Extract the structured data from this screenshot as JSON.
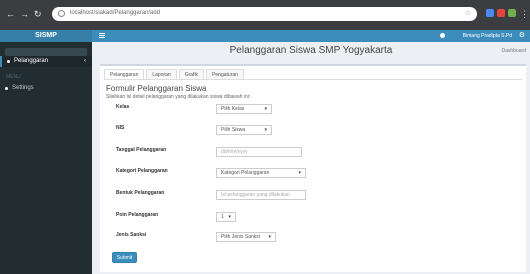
{
  "browser": {
    "url": "localhost/siakad/Pelanggaran/add",
    "colors": {
      "frame": "#3b3d41",
      "ext_red": "#e8453c",
      "ext_blue": "#4a8af4"
    }
  },
  "app": {
    "brand": "SISMP",
    "user_name": "Bintang Pradipta S.Pd",
    "colors": {
      "primary": "#3c8dbc",
      "sidebar": "#222d32"
    }
  },
  "sidebar": {
    "items": [
      {
        "label": "Pelanggaran",
        "active": true
      },
      {
        "label": "Settings",
        "active": false
      }
    ],
    "header_label": "MENU"
  },
  "page": {
    "title": "Pelanggaran Siswa SMP Yogyakarta",
    "action": "Dashboard"
  },
  "tabs": [
    "Pelanggaran",
    "Laporan",
    "Grafik",
    "Pengaturan"
  ],
  "form": {
    "title": "Formulir Pelanggaran Siswa",
    "subtitle": "Silahkan isi detail pelanggaran yang dilakukan siswa dibawah ini:",
    "fields": [
      {
        "label": "Kelas",
        "value": "Pilih Kelas",
        "type": "select"
      },
      {
        "label": "NIS",
        "value": "Pilih Siswa",
        "type": "select"
      },
      {
        "label": "Tanggal Pelanggaran",
        "value": "dd/mm/yyyy",
        "type": "input"
      },
      {
        "label": "Kategori Pelanggaran",
        "value": "Kategori Pelanggaran",
        "type": "select"
      },
      {
        "label": "Bentuk Pelanggaran",
        "value": "Isi pelanggaran yang dilakukan",
        "type": "input"
      },
      {
        "label": "Poin Pelanggaran",
        "value": "1",
        "type": "select"
      },
      {
        "label": "Jenis Sanksi",
        "value": "Pilih Jenis Sanksi",
        "type": "select"
      }
    ],
    "submit_label": "Submit"
  }
}
